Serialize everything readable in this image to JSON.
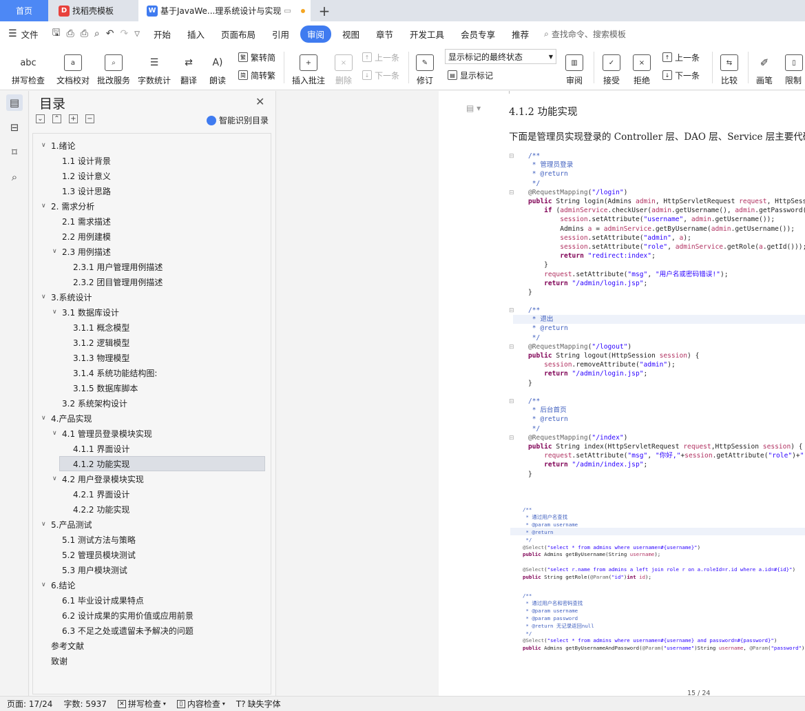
{
  "tabs": {
    "home": "首页",
    "template": "找稻壳模板",
    "document": "基于JavaWe...理系统设计与实现"
  },
  "menu": {
    "file": "文件",
    "items": [
      "开始",
      "插入",
      "页面布局",
      "引用",
      "审阅",
      "视图",
      "章节",
      "开发工具",
      "会员专享",
      "推荐"
    ],
    "active": "审阅",
    "search": "查找命令、搜索模板"
  },
  "ribbon": {
    "spellcheck": "拼写检查",
    "doccheck": "文档校对",
    "batch": "批改服务",
    "wordcount": "字数统计",
    "translate": "翻译",
    "read": "朗读",
    "to_trad": "繁转简",
    "to_simp": "简转繁",
    "insert_comment": "插入批注",
    "delete": "删除",
    "prev": "上一条",
    "next": "下一条",
    "revise": "修订",
    "markup_state": "显示标记的最终状态",
    "show_markup": "显示标记",
    "review": "审阅",
    "accept": "接受",
    "reject": "拒绝",
    "prev2": "上一条",
    "next2": "下一条",
    "compare": "比较",
    "pen": "画笔",
    "restrict": "限制"
  },
  "toc": {
    "title": "目录",
    "smart": "智能识别目录",
    "items": [
      "1.绪论",
      "1.1 设计背景",
      "1.2 设计意义",
      "1.3 设计思路",
      "2. 需求分析",
      "2.1  需求描述",
      "2.2  用例建模",
      "2.3  用例描述",
      "2.3.1  用户管理用例描述",
      "2.3.2  团目管理用例描述",
      "3.系统设计",
      "3.1  数据库设计",
      "3.1.1  概念模型",
      "3.1.2  逻辑模型",
      "3.1.3  物理模型",
      "3.1.4  系统功能结构图:",
      "3.1.5  数据库脚本",
      "3.2  系统架构设计",
      "4.产品实现",
      "4.1  管理员登录模块实现",
      "4.1.1  界面设计",
      "4.1.2  功能实现",
      "4.2  用户登录模块实现",
      "4.2.1  界面设计",
      "4.2.2  功能实现",
      "5.产品测试",
      "5.1  测试方法与策略",
      "5.2 管理员模块测试",
      "5.3  用户模块测试",
      "6.结论",
      "6.1 毕业设计成果特点",
      "6.2 设计成果的实用价值或应用前景",
      "6.3 不足之处或遗留未予解决的问题",
      "参考文献",
      "致谢"
    ]
  },
  "document": {
    "heading": "4.1.2  功能实现",
    "paragraph": "下面是管理员实现登录的 Controller 层、DAO 层、Service 层主要代码",
    "page_number": "15 / 24"
  },
  "status": {
    "page": "页面: 17/24",
    "words": "字数: 5937",
    "spell": "拼写检查",
    "content": "内容检查",
    "missing_font": "缺失字体"
  },
  "colors": {
    "accent": "#3f7bf0",
    "home_tab": "#4d88f5"
  }
}
